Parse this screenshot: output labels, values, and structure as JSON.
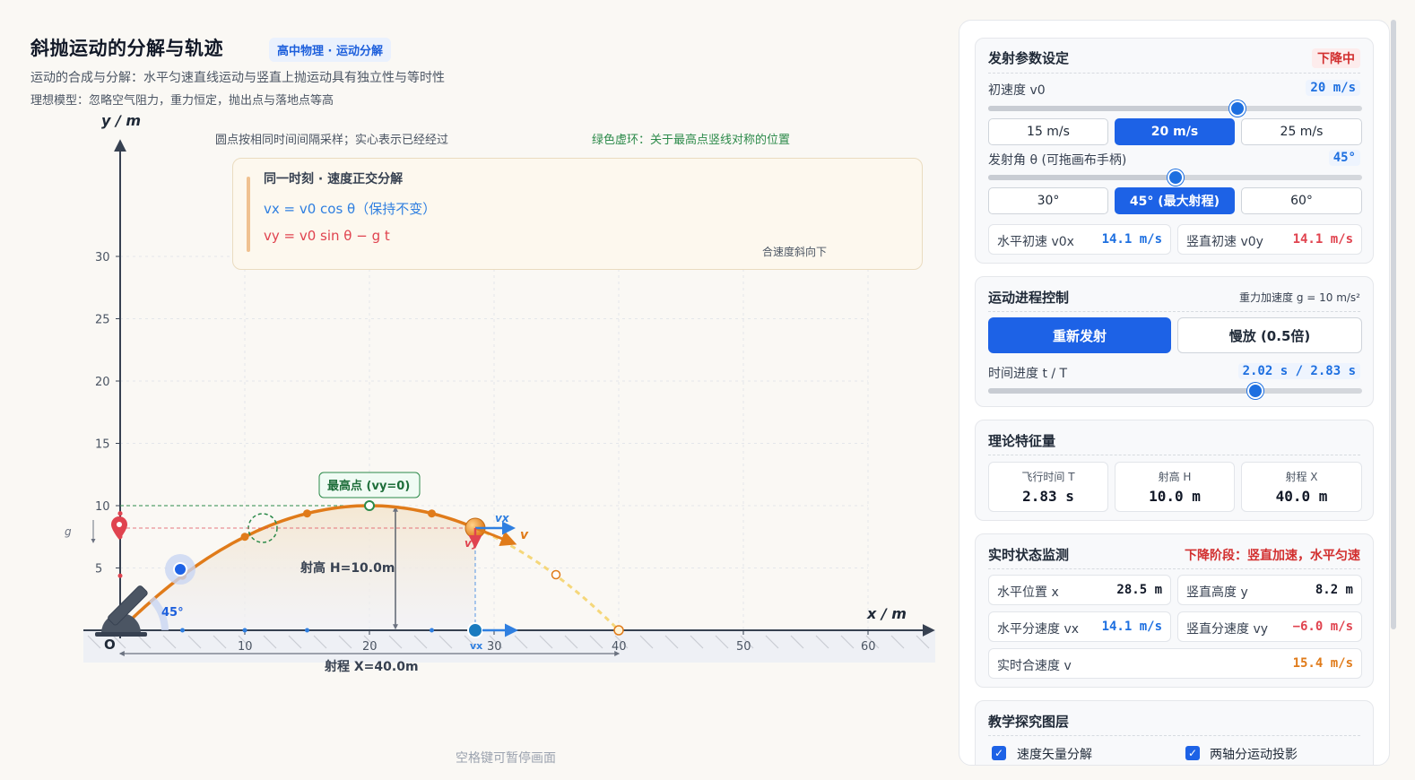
{
  "header": {
    "title": "斜抛运动的分解与轨迹",
    "tag": "高中物理 · 运动分解",
    "subtitle1": "运动的合成与分解：水平匀速直线运动与竖直上抛运动具有独立性与等时性",
    "subtitle2": "理想模型：忽略空气阻力，重力恒定，抛出点与落地点等高"
  },
  "canvas": {
    "note_left": "圆点按相同时间间隔采样；实心表示已经经过",
    "note_right": "绿色虚环：关于最高点竖线对称的位置",
    "legend_title": "同一时刻 · 速度正交分解",
    "legend_vx": "vx = v0 cos θ（保持不变）",
    "legend_vy": "vy = v0 sin θ − g t",
    "legend_note": "合速度斜向下",
    "pause_hint": "空格键可暂停画面",
    "y_axis_label": "y / m",
    "x_axis_label": "x / m",
    "origin_label": "O",
    "x_ticks": [
      "10",
      "20",
      "30",
      "40",
      "50",
      "60"
    ],
    "y_ticks": [
      "5",
      "10",
      "15",
      "20",
      "25",
      "30"
    ],
    "apex_label": "最高点 (vy=0)",
    "height_label": "射高 H=10.0m",
    "range_label": "射程 X=40.0m",
    "angle_label": "45°",
    "g_label": "g",
    "v_label": "v",
    "vx_label": "vx",
    "vy_label": "vy",
    "colors": {
      "trajectory": "#e07b1a",
      "vx": "#2f7fe0",
      "vy": "#e0434f",
      "apex": "#2c8a4a"
    }
  },
  "chart_data": {
    "type": "scatter",
    "title": "",
    "xlabel": "x / m",
    "ylabel": "y / m",
    "xlim": [
      0,
      60
    ],
    "ylim": [
      0,
      30
    ],
    "trajectory": {
      "v0": 20,
      "theta_deg": 45,
      "g": 10
    },
    "ball": {
      "x": 28.5,
      "y": 8.2
    },
    "apex": {
      "x": 20,
      "y": 10
    },
    "landing": {
      "x": 40,
      "y": 0
    },
    "sample_points_passed_x": [
      5,
      10,
      15,
      20,
      25
    ],
    "sample_points_future_x": [
      35
    ]
  },
  "panel": {
    "launch": {
      "title": "发射参数设定",
      "status": "下降中",
      "v0_label": "初速度 v0",
      "v0_value": "20 m/s",
      "v0_fraction": 0.6667,
      "v0_presets": [
        "15 m/s",
        "20 m/s",
        "25 m/s"
      ],
      "angle_label": "发射角 θ (可拖画布手柄)",
      "angle_value": "45°",
      "angle_fraction": 0.5,
      "angle_presets": [
        "30°",
        "45° (最大射程)",
        "60°"
      ],
      "v0x_label": "水平初速 v0x",
      "v0x_value": "14.1 m/s",
      "v0y_label": "竖直初速 v0y",
      "v0y_value": "14.1 m/s"
    },
    "progress": {
      "title": "运动进程控制",
      "gravity_note": "重力加速度 g = 10 m/s²",
      "relaunch": "重新发射",
      "slowmo": "慢放 (0.5倍)",
      "time_label": "时间进度 t / T",
      "time_value": "2.02 s / 2.83 s",
      "time_fraction": 0.714
    },
    "theory": {
      "title": "理论特征量",
      "flight_label": "飞行时间 T",
      "flight_value": "2.83 s",
      "height_label": "射高 H",
      "height_value": "10.0 m",
      "range_label": "射程 X",
      "range_value": "40.0 m"
    },
    "monitor": {
      "title": "实时状态监测",
      "phase": "下降阶段：竖直加速，水平匀速",
      "x_label": "水平位置 x",
      "x_value": "28.5 m",
      "y_label": "竖直高度 y",
      "y_value": "8.2 m",
      "vx_label": "水平分速度 vx",
      "vx_value": "14.1 m/s",
      "vy_label": "竖直分速度 vy",
      "vy_value": "−6.0 m/s",
      "v_label": "实时合速度 v",
      "v_value": "15.4 m/s"
    },
    "layers": {
      "title": "教学探究图层",
      "opt1": "速度矢量分解",
      "opt2": "两轴分运动投影"
    }
  }
}
